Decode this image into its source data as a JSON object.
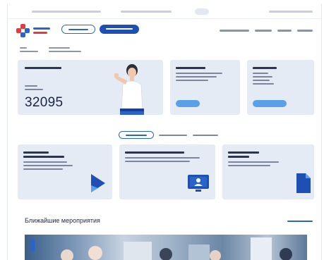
{
  "topbar": {
    "left_text": "",
    "middle_text": "",
    "language": "",
    "right_text": ""
  },
  "header": {
    "logo_name": "",
    "logo_subtitle": "",
    "outline_button": "",
    "solid_button": "",
    "nav_items": [
      "",
      "",
      "",
      ""
    ]
  },
  "breadcrumb": {
    "items": [
      "",
      ""
    ]
  },
  "hero_card": {
    "title": "",
    "caption": "",
    "counter_value": "32095"
  },
  "side_cards": [
    {
      "title": "",
      "text": "",
      "button": ""
    },
    {
      "title": "",
      "text": "",
      "button": ""
    }
  ],
  "tabs": {
    "active": "",
    "items": [
      "",
      ""
    ]
  },
  "feature_cards": [
    {
      "title": "",
      "text": "",
      "icon": "play-icon"
    },
    {
      "title": "",
      "text": "",
      "icon": "monitor-person-icon"
    },
    {
      "title": "",
      "text": "",
      "icon": "document-icon"
    }
  ],
  "events_section": {
    "title": "Ближайшие мероприятия",
    "link": ""
  },
  "colors": {
    "primary": "#1e4fb3",
    "accent": "#5aa0e8",
    "card_bg": "#e4ebf5",
    "logo_red": "#e63b3b",
    "logo_blue": "#2a64c8"
  }
}
